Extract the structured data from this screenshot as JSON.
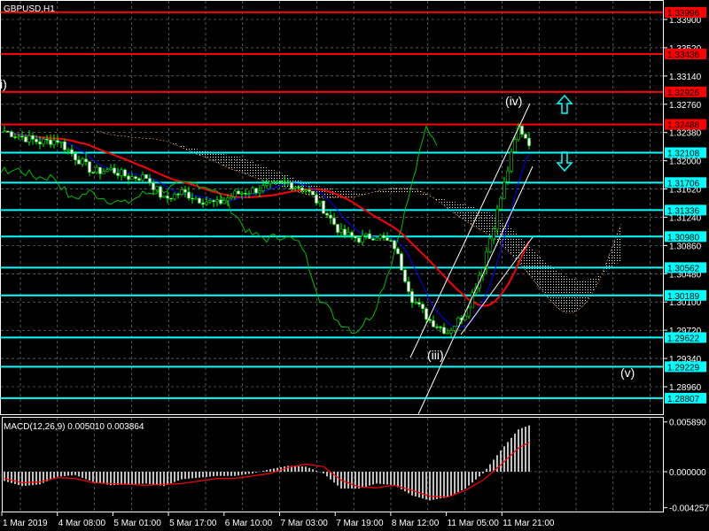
{
  "title": "GBPUSD,H1",
  "colors": {
    "background": "#000000",
    "grid": "#8090a0",
    "resistance": "#ff0000",
    "support": "#00ffff",
    "bull": "#00ff00",
    "bear": "#ffffff",
    "ma": "#ff0000",
    "kijun": "#0000ff",
    "chikou": "#00c000",
    "cloud_a": "#f0f0f0",
    "cloud_b": "#ffa060",
    "macd_hist": "#c0c0c0",
    "macd_signal": "#ff0000"
  },
  "price_axis": {
    "ticks": [
      "1.33900",
      "1.33520",
      "1.33140",
      "1.32760",
      "1.32380",
      "1.32000",
      "1.31620",
      "1.31240",
      "1.30860",
      "1.30480",
      "1.30100",
      "1.29720",
      "1.29340",
      "1.28960"
    ]
  },
  "levels": [
    {
      "price": "1.33996",
      "type": "resistance"
    },
    {
      "price": "1.33436",
      "type": "resistance"
    },
    {
      "price": "1.32926",
      "type": "resistance"
    },
    {
      "price": "1.32488",
      "type": "resistance"
    },
    {
      "price": "1.32108",
      "type": "support"
    },
    {
      "price": "1.31706",
      "type": "support"
    },
    {
      "price": "1.31336",
      "type": "support"
    },
    {
      "price": "1.30980",
      "type": "support"
    },
    {
      "price": "1.30562",
      "type": "support"
    },
    {
      "price": "1.30189",
      "type": "support"
    },
    {
      "price": "1.29622",
      "type": "support"
    },
    {
      "price": "1.29229",
      "type": "support"
    },
    {
      "price": "1.28807",
      "type": "support"
    }
  ],
  "wave_labels": {
    "w1": "i)",
    "w3": "(iii)",
    "w4": "(iv)",
    "w5": "(v)"
  },
  "arrows": [
    {
      "icon": "arrow-up-outline",
      "color": "#00ffff"
    },
    {
      "icon": "arrow-down-outline",
      "color": "#00ffff"
    }
  ],
  "time_axis": {
    "ticks": [
      "1 Mar 2019",
      "4 Mar 08:00",
      "5 Mar 01:00",
      "5 Mar 17:00",
      "6 Mar 10:00",
      "7 Mar 03:00",
      "7 Mar 19:00",
      "8 Mar 12:00",
      "11 Mar 05:00",
      "11 Mar 21:00"
    ]
  },
  "macd": {
    "label": "MACD(12,26,9) 0.005010 0.003864",
    "ticks": [
      "0.005890",
      "0.000000",
      "-0.004257"
    ]
  },
  "chart_data": [
    {
      "type": "candlestick",
      "symbol": "GBPUSD",
      "timeframe": "H1",
      "ylim": [
        1.287,
        1.342
      ],
      "approx_close": [
        1.324,
        1.3232,
        1.3225,
        1.3228,
        1.3205,
        1.3185,
        1.3188,
        1.3178,
        1.3178,
        1.3148,
        1.3158,
        1.3148,
        1.3142,
        1.3155,
        1.316,
        1.3166,
        1.317,
        1.3162,
        1.3135,
        1.3102,
        1.3095,
        1.31,
        1.3085,
        1.3015,
        1.2985,
        1.297,
        1.2995,
        1.306,
        1.315,
        1.3245,
        1.3212
      ]
    },
    {
      "type": "bar",
      "name": "MACD(12,26,9)",
      "ylim": [
        -0.004257,
        0.00589
      ],
      "approx_histogram": [
        -0.0011,
        -0.0017,
        -0.0015,
        -0.0006,
        -0.0004,
        -0.0012,
        -0.0016,
        -0.0015,
        -0.0014,
        -0.0017,
        -0.0009,
        -0.0007,
        -0.0005,
        -0.0005,
        -0.0002,
        0.0003,
        0.0007,
        0.0006,
        -0.0002,
        -0.002,
        -0.002,
        -0.0014,
        -0.0016,
        -0.0028,
        -0.0034,
        -0.003,
        -0.002,
        -0.0002,
        0.0025,
        0.005,
        0.0058
      ],
      "approx_signal": [
        -0.0008,
        -0.0013,
        -0.0012,
        -0.0007,
        -0.0008,
        -0.0013,
        -0.0014,
        -0.0015,
        -0.0016,
        -0.0015,
        -0.0014,
        -0.0011,
        -0.0008,
        -0.0008,
        -0.0005,
        -0.0002,
        0.0005,
        0.0009,
        0.0006,
        -0.001,
        -0.0018,
        -0.0019,
        -0.0016,
        -0.0022,
        -0.0029,
        -0.003,
        -0.0022,
        -0.001,
        0.0008,
        0.0028,
        0.0039
      ]
    }
  ]
}
